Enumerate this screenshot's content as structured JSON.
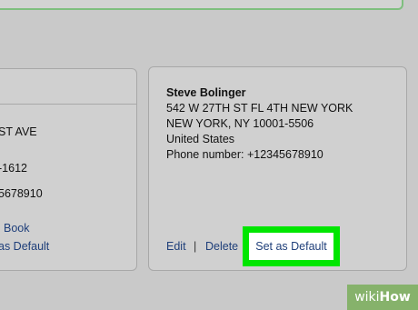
{
  "left_card": {
    "address_fragment": "ST AVE",
    "phone_fragment": "-1612",
    "number_fragment": "5678910",
    "link_book": "Book",
    "link_default": "as Default"
  },
  "right_card": {
    "name": "Steve Bolinger",
    "street": "542 W 27TH ST FL 4TH NEW YORK",
    "city_line": "NEW YORK, NY 10001-5506",
    "country": "United States",
    "phone": "Phone number: +12345678910",
    "actions": {
      "edit": "Edit",
      "separator": "|",
      "delete": "Delete",
      "set_default": "Set as Default"
    }
  },
  "highlight_color": "#00e600",
  "watermark": {
    "prefix": "wiki",
    "suffix": "How"
  }
}
